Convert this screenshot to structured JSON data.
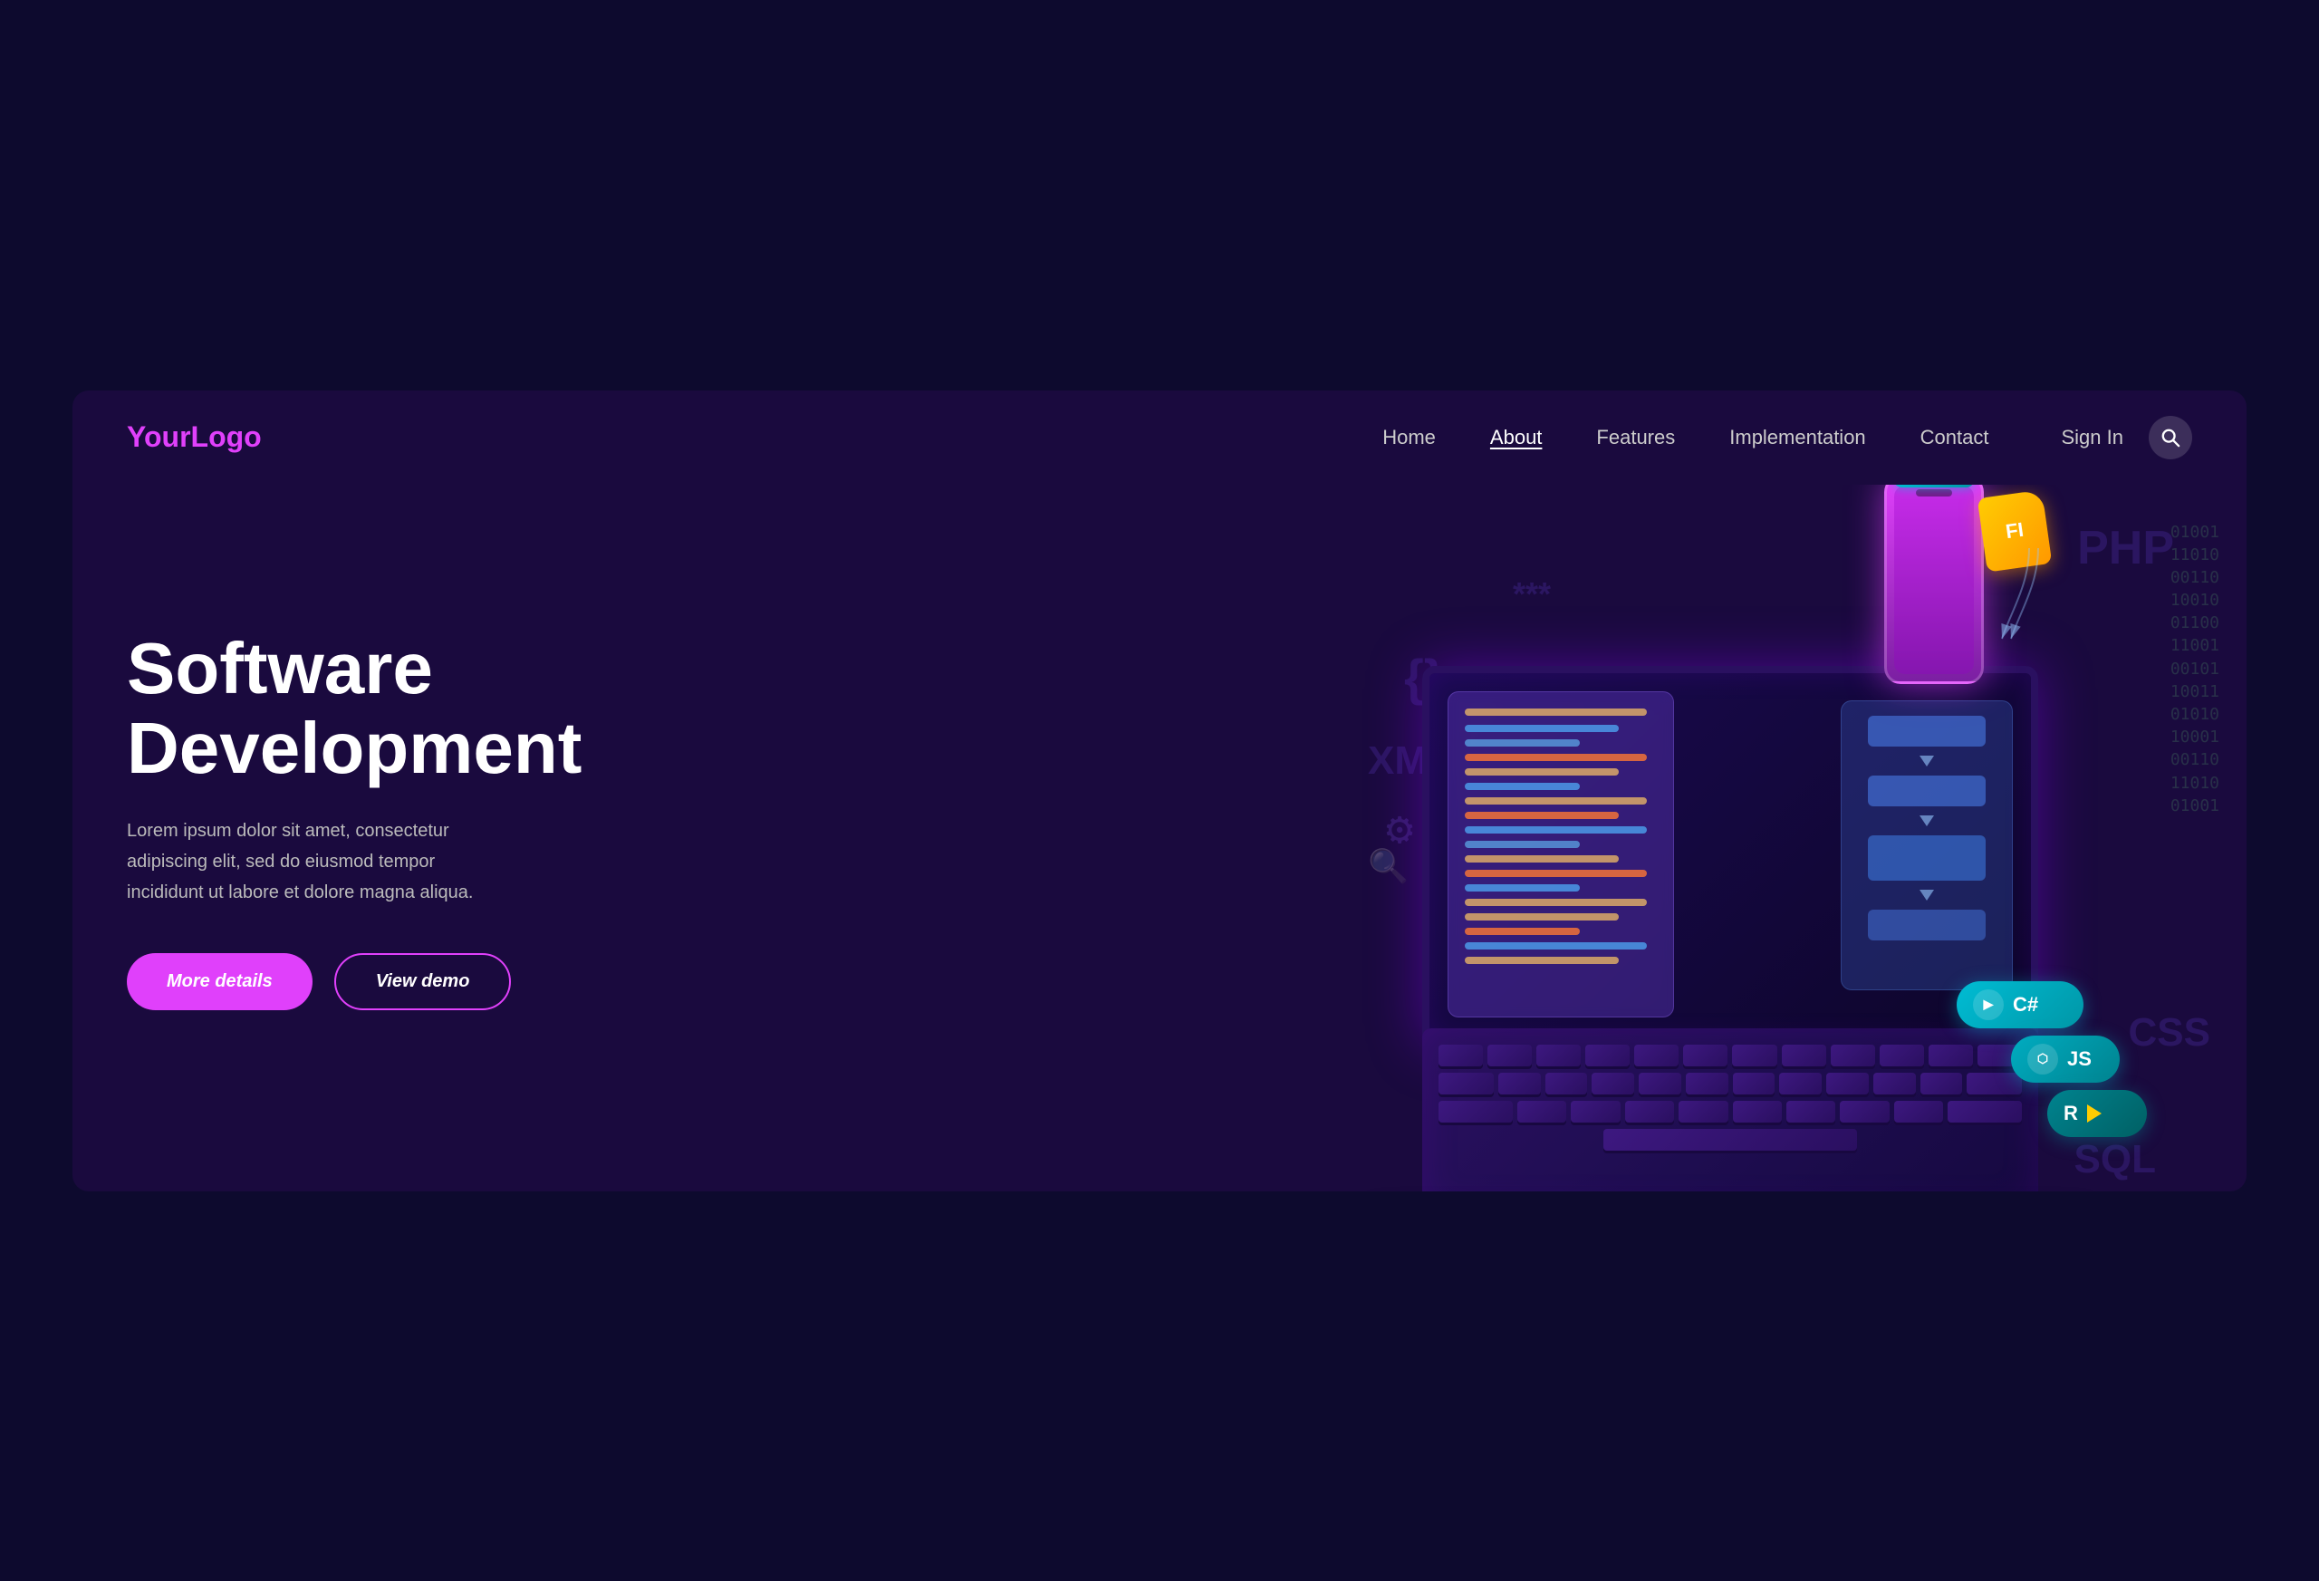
{
  "page": {
    "background_outer": "#0d0a2e",
    "background_inner": "#1a0a3e"
  },
  "navbar": {
    "logo": "YourLogo",
    "links": [
      {
        "label": "Home",
        "active": false
      },
      {
        "label": "About",
        "active": true
      },
      {
        "label": "Features",
        "active": false
      },
      {
        "label": "Implementation",
        "active": false
      },
      {
        "label": "Contact",
        "active": false
      }
    ],
    "sign_in": "Sign In",
    "search_placeholder": "Search"
  },
  "hero": {
    "title_line1": "Software",
    "title_line2": "Development",
    "description": "Lorem ipsum dolor sit amet, consectetur adipiscing elit, sed do eiusmod tempor incididunt ut labore et dolore magna aliqua.",
    "btn_primary": "More details",
    "btn_outline": "View demo"
  },
  "tech_tags": [
    {
      "label": "C#",
      "color": "#00bcd4"
    },
    {
      "label": "JS",
      "color": "#00acc1"
    },
    {
      "label": "R",
      "color": "#00838f"
    }
  ],
  "bg_labels": [
    "PHP",
    "XML",
    "CSS",
    "SQL",
    "{}",
    "***"
  ]
}
